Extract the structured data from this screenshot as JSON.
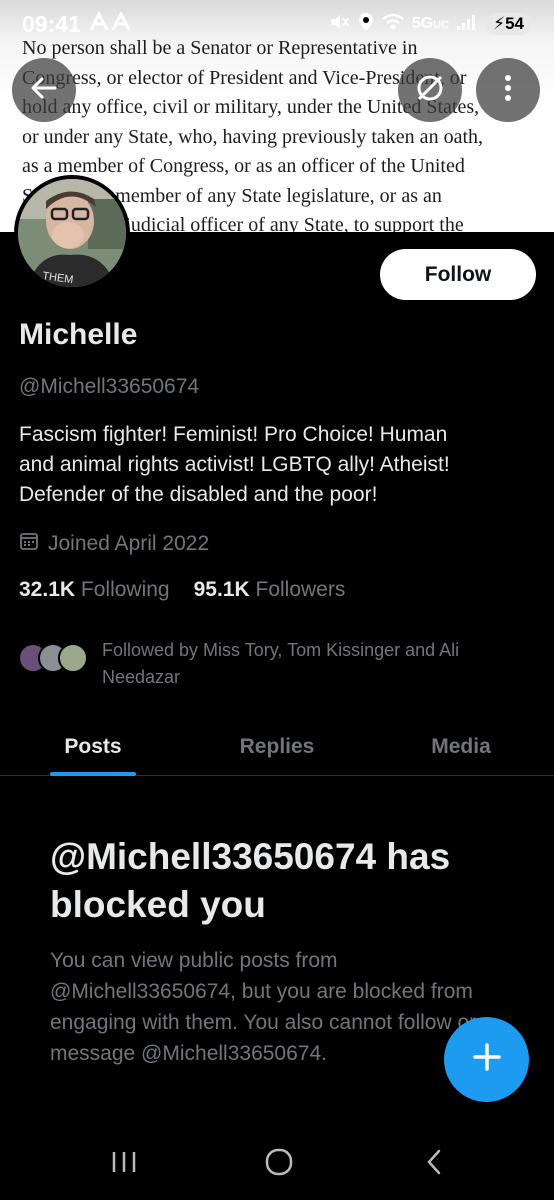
{
  "status_bar": {
    "time": "09:41",
    "network": "5G",
    "network_suffix": "UC",
    "battery": "54"
  },
  "banner": {
    "lines": [
      "No person shall be a Senator or Representative in",
      "Congress, or elector of President and Vice-President, or",
      "hold any office, civil or military, under the United States,",
      "or under any State, who, having previously taken an oath,",
      "as a member of Congress, or as an officer of the United",
      "States, as a member of any State legislature, or as an",
      "executive or judicial officer of any State, to support the"
    ]
  },
  "header": {
    "back_icon": "arrow-left-icon",
    "grok_icon": "grok-icon",
    "more_icon": "more-vertical-icon"
  },
  "profile": {
    "follow_label": "Follow",
    "name": "Michelle",
    "handle": "@Michell33650674",
    "bio": "Fascism fighter! Feminist! Pro Choice! Human\nand animal rights activist! LGBTQ ally!  Atheist!\nDefender of the disabled and the poor!",
    "joined": "Joined April 2022",
    "following_count": "32.1K",
    "following_label": "Following",
    "followers_count": "95.1K",
    "followers_label": "Followers",
    "followed_by": "Followed by Miss Tory, Tom Kissinger and Ali Needazar"
  },
  "tabs": [
    {
      "label": "Posts",
      "active": true
    },
    {
      "label": "Replies",
      "active": false
    },
    {
      "label": "Media",
      "active": false
    }
  ],
  "blocked": {
    "title": "@Michell33650674 has blocked you",
    "description": "You can view public posts from @Michell33650674, but you are blocked from engaging with them. You also cannot follow or message @Michell33650674."
  },
  "colors": {
    "accent": "#1d9bf0",
    "background": "#000000",
    "secondary_text": "#71767b"
  }
}
